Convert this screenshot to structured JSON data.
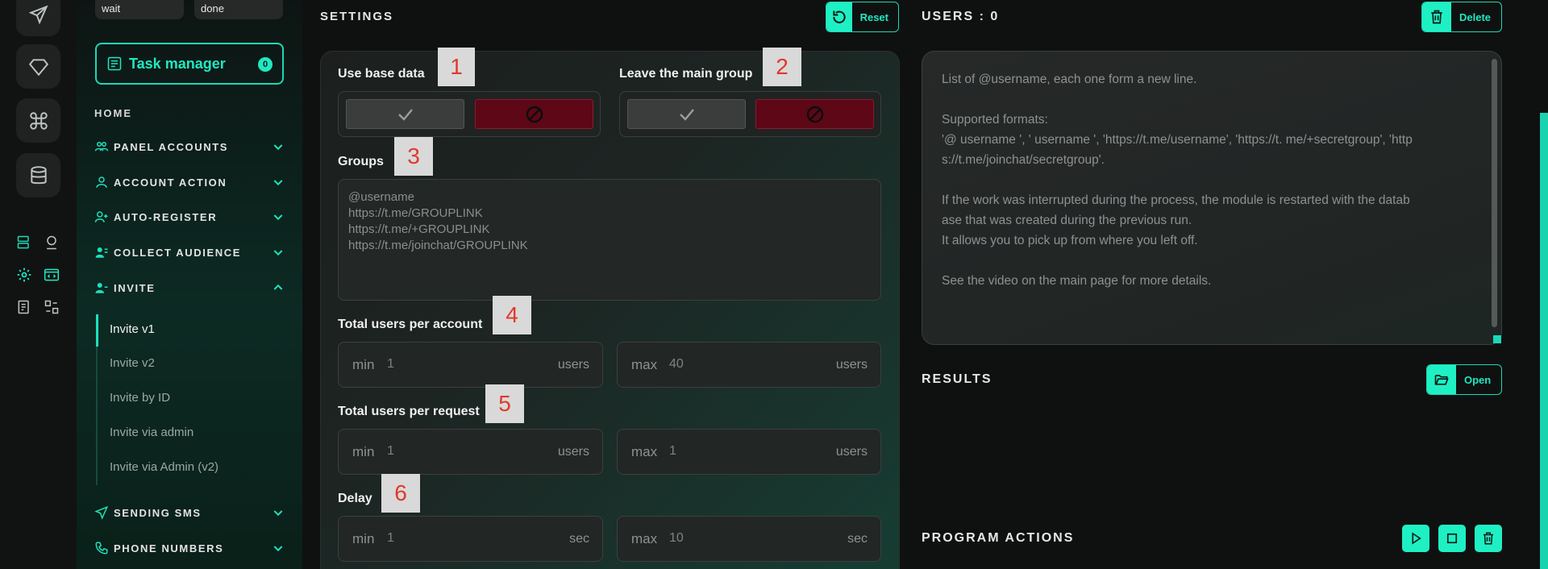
{
  "status_pills": [
    "wait",
    "done"
  ],
  "task_manager": {
    "label": "Task manager",
    "count": "0"
  },
  "nav": {
    "home": "HOME",
    "items": [
      {
        "label": "PANEL ACCOUNTS",
        "icon": "users-icon",
        "expanded": false
      },
      {
        "label": "ACCOUNT ACTION",
        "icon": "user-icon",
        "expanded": false
      },
      {
        "label": "AUTO-REGISTER",
        "icon": "user-plus-icon",
        "expanded": false
      },
      {
        "label": "COLLECT AUDIENCE",
        "icon": "user-list-icon",
        "expanded": false
      },
      {
        "label": "INVITE",
        "icon": "user-invite-icon",
        "expanded": true
      },
      {
        "label": "SENDING SMS",
        "icon": "send-icon",
        "expanded": false
      },
      {
        "label": "PHONE NUMBERS",
        "icon": "phone-icon",
        "expanded": false
      }
    ],
    "invite_sub": [
      "Invite v1",
      "Invite v2",
      "Invite by ID",
      "Invite via admin",
      "Invite via Admin (v2)"
    ],
    "active_sub": "Invite v1"
  },
  "settings": {
    "title": "SETTINGS",
    "reset_label": "Reset",
    "use_base_data": "Use base data",
    "leave_main_group": "Leave the main group",
    "groups_label": "Groups",
    "groups_placeholder": "@username\nhttps://t.me/GROUPLINK\nhttps://t.me/+GROUPLINK\nhttps://t.me/joinchat/GROUPLINK",
    "total_users_per_account": "Total users per account",
    "total_users_per_request": "Total users per request",
    "delay": "Delay",
    "fields": {
      "per_account": {
        "min_label": "min",
        "min": "1",
        "max_label": "max",
        "max": "40",
        "unit": "users"
      },
      "per_request": {
        "min_label": "min",
        "min": "1",
        "max_label": "max",
        "max": "1",
        "unit": "users"
      },
      "delay": {
        "min_label": "min",
        "min": "1",
        "max_label": "max",
        "max": "10",
        "unit": "sec"
      }
    },
    "markers": [
      "1",
      "2",
      "3",
      "4",
      "5",
      "6"
    ]
  },
  "users": {
    "title": "USERS : 0",
    "delete_label": "Delete",
    "placeholder": "List of @username, each one form a new line.\n\nSupported formats:\n'@ username ', ' username ', 'https://t.me/username', 'https://t. me/+secretgroup', 'http\ns://t.me/joinchat/secretgroup'.\n\nIf the work was interrupted during the process, the module is restarted with the datab\nase that was created during the previous run.\nIt allows you to pick up from where you left off.\n\nSee the video on the main page for more details."
  },
  "results": {
    "title": "RESULTS",
    "open_label": "Open"
  },
  "program_actions": {
    "title": "PROGRAM ACTIONS"
  },
  "colors": {
    "accent": "#1ff0c4",
    "danger": "#5d0717",
    "background": "#0f1110"
  }
}
